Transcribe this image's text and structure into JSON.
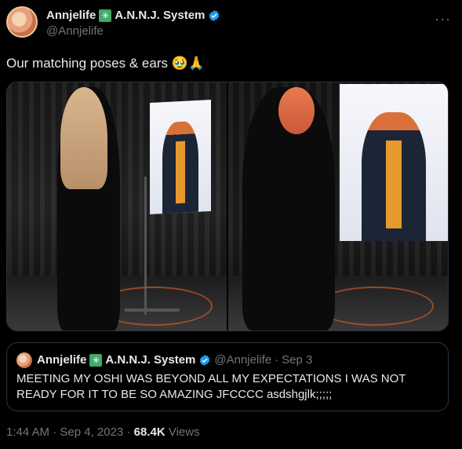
{
  "author": {
    "name": "Annjelife",
    "system_icon": "sparkle-box-icon",
    "system_name": "A.N.N.J. System",
    "handle": "@Annjelife",
    "verified": true
  },
  "more_label": "···",
  "post_text": "Our matching poses & ears 🥹🙏",
  "media": {
    "count": 2,
    "items": [
      "photo-cosplayer-back-with-screen",
      "photo-cosplayer-front-with-screen"
    ]
  },
  "quote": {
    "name": "Annjelife",
    "system_name": "A.N.N.J. System",
    "handle": "@Annjelife",
    "separator": "·",
    "date": "Sep 3",
    "text": "MEETING MY OSHI WAS BEYOND ALL MY EXPECTATIONS I WAS NOT READY FOR IT TO BE SO AMAZING JFCCCC asdshgjlk;;;;;"
  },
  "meta": {
    "time": "1:44 AM",
    "sep1": "·",
    "date": "Sep 4, 2023",
    "sep2": "·",
    "views_count": "68.4K",
    "views_label": "Views"
  },
  "colors": {
    "background": "#000000",
    "text": "#e7e9ea",
    "muted": "#71767b",
    "verified": "#1d9bf0",
    "border": "#2f3336"
  }
}
